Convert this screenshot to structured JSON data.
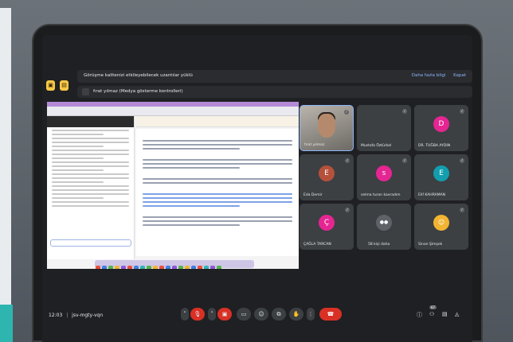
{
  "banner": {
    "text": "Görüşme kalitenizi etkileyebilecek uzantılar yüklü",
    "details_label": "Daha fazla bilgi",
    "close_label": "Kapat"
  },
  "notice": {
    "text": "fırat yılmaz (Medya gösterme kontrolleri)"
  },
  "participants": [
    {
      "name": "fırat yılmaz",
      "initial": "",
      "color": "",
      "camera": true
    },
    {
      "name": "Mustafa Öztürkel",
      "initial": "",
      "color": "#3c4043",
      "camera": false
    },
    {
      "name": "DR. TUĞBA AYDIN",
      "initial": "D",
      "color": "#e52592",
      "camera": false
    },
    {
      "name": "Eda Demir",
      "initial": "E",
      "color": "#b5513b",
      "camera": false
    },
    {
      "name": "selma turan kavradım",
      "initial": "s",
      "color": "#e52592",
      "camera": false
    },
    {
      "name": "Elif KAHRAMAN",
      "initial": "E",
      "color": "#129eaf",
      "camera": false
    },
    {
      "name": "ÇAĞLA TARCAN",
      "initial": "Ç",
      "color": "#e52592",
      "camera": false
    },
    {
      "name": "58 kişi daha",
      "initial": "",
      "color": "#3c4043",
      "camera": false
    },
    {
      "name": "Sinan Şimşek",
      "initial": "",
      "color": "#3c4043",
      "camera": false
    }
  ],
  "controls": {
    "time": "12:03",
    "separator": "|",
    "meeting_code": "jsv-mgty-vqn",
    "badge_count": "67"
  },
  "colors": {
    "accent": "#8ab4f8",
    "danger": "#d93025",
    "tile": "#3c4043"
  }
}
